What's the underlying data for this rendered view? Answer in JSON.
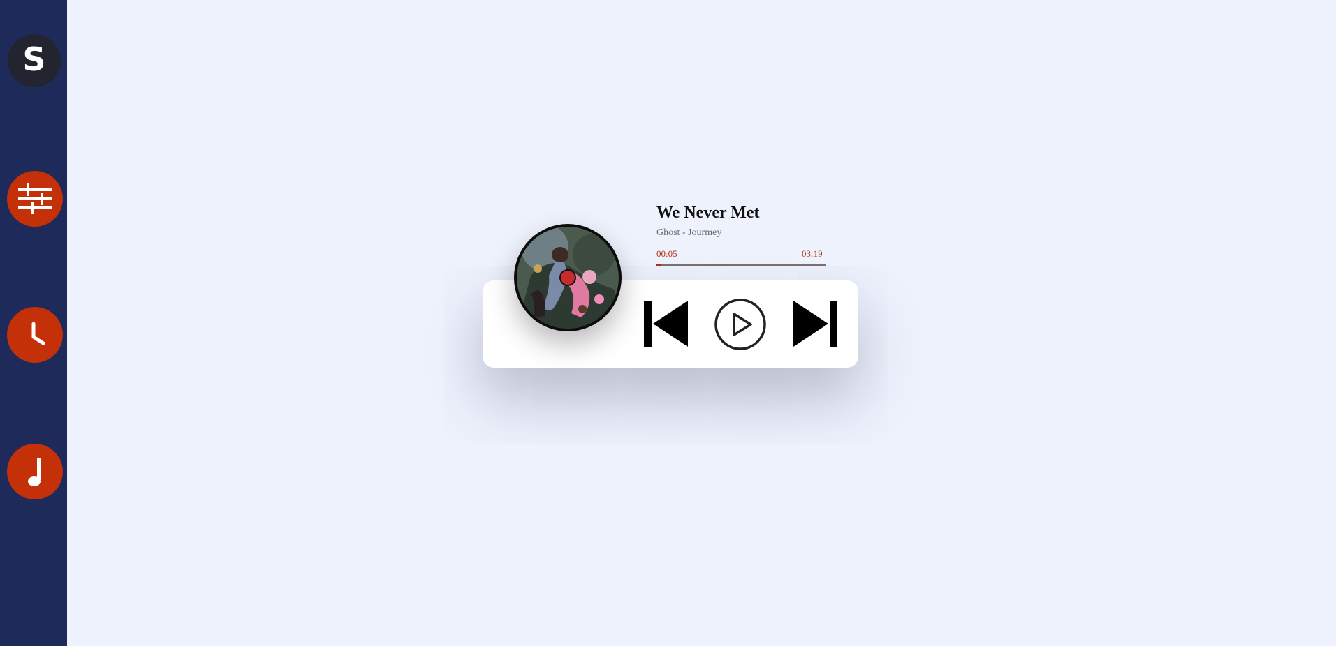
{
  "sidebar": {
    "logo_letter": "S",
    "items": [
      {
        "name": "settings",
        "icon": "sliders-icon"
      },
      {
        "name": "history",
        "icon": "clock-icon"
      },
      {
        "name": "music",
        "icon": "music-note-icon"
      }
    ]
  },
  "player": {
    "title": "We Never Met",
    "artist": "Ghost - Jourmey",
    "current_time": "00:05",
    "total_time": "03:19",
    "progress_percent": 2.5,
    "controls": {
      "prev_icon": "skip-previous-icon",
      "play_icon": "play-icon",
      "next_icon": "skip-next-icon"
    }
  },
  "colors": {
    "sidebar_bg": "#1e2a5a",
    "accent": "#c43008",
    "page_bg": "#eef2fd",
    "time_text": "#b2381a"
  }
}
